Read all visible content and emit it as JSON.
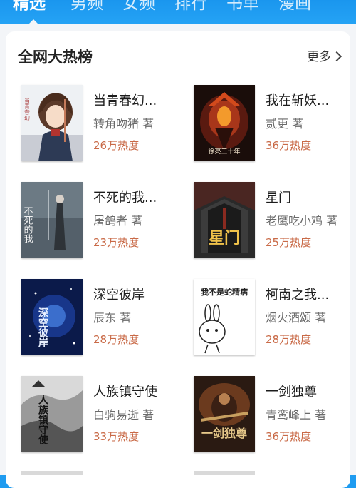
{
  "tabs": [
    {
      "label": "精选",
      "active": true
    },
    {
      "label": "男频",
      "active": false
    },
    {
      "label": "女频",
      "active": false
    },
    {
      "label": "排行",
      "active": false
    },
    {
      "label": "书单",
      "active": false
    },
    {
      "label": "漫画",
      "active": false
    }
  ],
  "section": {
    "title": "全网大热榜",
    "more_label": "更多"
  },
  "books": [
    {
      "title": "当青春幻...",
      "author": "转角吻猪 著",
      "heat": "26万热度"
    },
    {
      "title": "我在斩妖...",
      "author": "贰更 著",
      "heat": "36万热度"
    },
    {
      "title": "不死的我...",
      "author": "屠鸽者 著",
      "heat": "23万热度"
    },
    {
      "title": "星门",
      "author": "老鹰吃小鸡 著",
      "heat": "25万热度"
    },
    {
      "title": "深空彼岸",
      "author": "辰东 著",
      "heat": "28万热度"
    },
    {
      "title": "柯南之我...",
      "author": "烟火酒颂 著",
      "heat": "28万热度"
    },
    {
      "title": "人族镇守使",
      "author": "白驹易逝 著",
      "heat": "33万热度"
    },
    {
      "title": "一剑独尊",
      "author": "青鸾峰上 著",
      "heat": "36万热度"
    }
  ],
  "covers": [
    {
      "lines": [
        "当青春幻"
      ]
    },
    {
      "lines": [
        "徐亮三十年"
      ]
    },
    {
      "lines": [
        "不死的我"
      ]
    },
    {
      "lines": [
        "星门"
      ]
    },
    {
      "lines": [
        "深空彼岸"
      ]
    },
    {
      "lines": [
        "我不是蛇精病"
      ]
    },
    {
      "lines": [
        "人族镇守使"
      ]
    },
    {
      "lines": [
        "一剑独尊"
      ]
    }
  ],
  "colors": {
    "brand_blue": "#1e9bf0",
    "heat_orange": "#c96a47",
    "page_bg": "#f3f5f8"
  }
}
